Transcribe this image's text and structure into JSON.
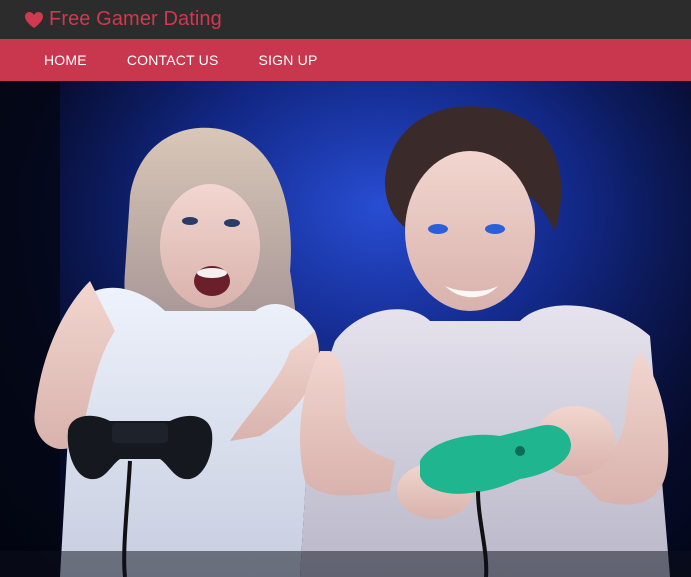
{
  "brand": {
    "icon": "heart-icon",
    "name": "Free Gamer Dating",
    "color": "#d0394f"
  },
  "nav": {
    "background": "#c8374e",
    "items": [
      {
        "label": "HOME"
      },
      {
        "label": "CONTACT US"
      },
      {
        "label": "SIGN UP"
      }
    ]
  },
  "hero": {
    "image": "couple-playing-video-games-photo"
  }
}
